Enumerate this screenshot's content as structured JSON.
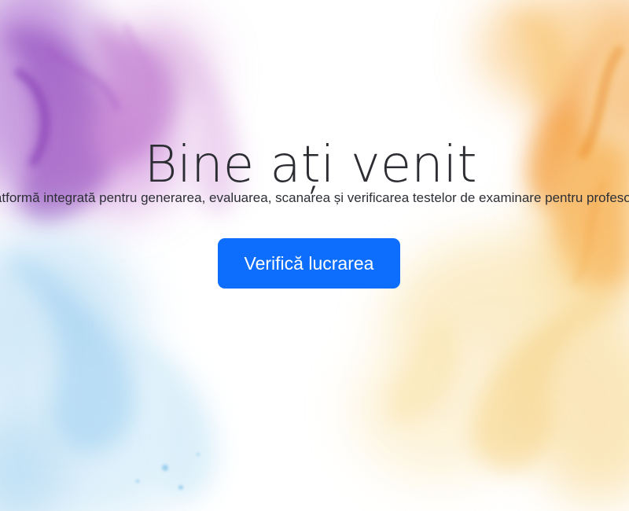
{
  "hero": {
    "title": "Bine ați venit",
    "subtitle": "Platformă integrată pentru generarea, evaluarea, scanarea și verificarea testelor de examinare pentru profesori",
    "button_label": "Verifică lucrarea"
  },
  "background": {
    "image": "watercolor-smoke-background",
    "colors": {
      "purple": "#9b4fc6",
      "magenta": "#c45bb4",
      "blue": "#6ab8e8",
      "orange": "#f39a2a",
      "yellow": "#f6d27a"
    }
  },
  "button": {
    "color": "#0d6efd"
  }
}
